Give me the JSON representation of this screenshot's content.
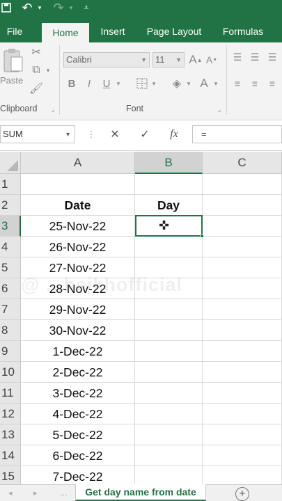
{
  "ribbon_tabs": [
    "File",
    "Home",
    "Insert",
    "Page Layout",
    "Formulas"
  ],
  "ribbon": {
    "paste_label": "Paste",
    "clipboard_label": "Clipboard",
    "font_label": "Font",
    "font_name": "Calibri",
    "font_size": "11",
    "bold": "B",
    "italic": "I",
    "underline": "U",
    "grow_font": "A",
    "shrink_font": "A",
    "font_color": "A"
  },
  "formula_bar": {
    "name_box": "SUM",
    "cancel": "✕",
    "enter": "✓",
    "fx": "fx",
    "formula": "="
  },
  "columns": [
    "A",
    "B",
    "C"
  ],
  "rows": [
    {
      "num": "1",
      "a": "",
      "b": ""
    },
    {
      "num": "2",
      "a": "Date",
      "b": "Day"
    },
    {
      "num": "3",
      "a": "25-Nov-22",
      "b": ""
    },
    {
      "num": "4",
      "a": "26-Nov-22",
      "b": ""
    },
    {
      "num": "5",
      "a": "27-Nov-22",
      "b": ""
    },
    {
      "num": "6",
      "a": "28-Nov-22",
      "b": ""
    },
    {
      "num": "7",
      "a": "29-Nov-22",
      "b": ""
    },
    {
      "num": "8",
      "a": "30-Nov-22",
      "b": ""
    },
    {
      "num": "9",
      "a": "1-Dec-22",
      "b": ""
    },
    {
      "num": "10",
      "a": "2-Dec-22",
      "b": ""
    },
    {
      "num": "11",
      "a": "3-Dec-22",
      "b": ""
    },
    {
      "num": "12",
      "a": "4-Dec-22",
      "b": ""
    },
    {
      "num": "13",
      "a": "5-Dec-22",
      "b": ""
    },
    {
      "num": "14",
      "a": "6-Dec-22",
      "b": ""
    },
    {
      "num": "15",
      "a": "7-Dec-22",
      "b": ""
    }
  ],
  "active_cell": "B3",
  "watermark": "@ ...heikhofficial",
  "sheet_tab": "Get day name from date",
  "colors": {
    "accent": "#217346",
    "ribbon_bg": "#f3f3f3",
    "header_bg": "#e6e6e6"
  }
}
